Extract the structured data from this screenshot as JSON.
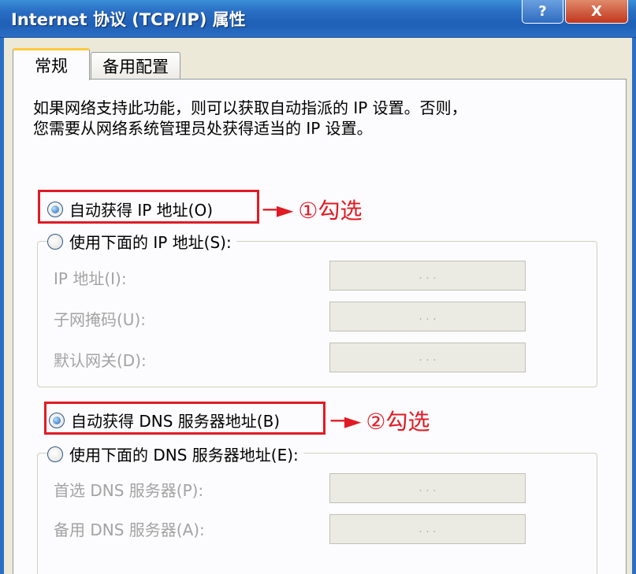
{
  "window": {
    "title": "Internet 协议 (TCP/IP) 属性",
    "help_btn": "?",
    "close_btn": "X"
  },
  "tabs": [
    {
      "label": "常规",
      "active": true
    },
    {
      "label": "备用配置",
      "active": false
    }
  ],
  "description": "如果网络支持此功能，则可以获取自动指派的 IP 设置。否则，\n您需要从网络系统管理员处获得适当的 IP 设置。",
  "ip_section": {
    "auto_option": "自动获得 IP 地址(O)",
    "manual_option": "使用下面的 IP 地址(S):",
    "auto_selected": true,
    "fields": [
      {
        "label": "IP 地址(I):",
        "value": ". . ."
      },
      {
        "label": "子网掩码(U):",
        "value": ". . ."
      },
      {
        "label": "默认网关(D):",
        "value": ". . ."
      }
    ]
  },
  "dns_section": {
    "auto_option": "自动获得 DNS 服务器地址(B)",
    "manual_option": "使用下面的 DNS 服务器地址(E):",
    "auto_selected": true,
    "fields": [
      {
        "label": "首选 DNS 服务器(P):",
        "value": ". . ."
      },
      {
        "label": "备用 DNS 服务器(A):",
        "value": ". . ."
      }
    ]
  },
  "annotations": [
    {
      "arrow": "─►",
      "text": "①勾选"
    },
    {
      "arrow": "─►",
      "text": "②勾选"
    }
  ],
  "colors": {
    "highlight": "#e01b24",
    "title_bar": "#2a6fc4"
  }
}
